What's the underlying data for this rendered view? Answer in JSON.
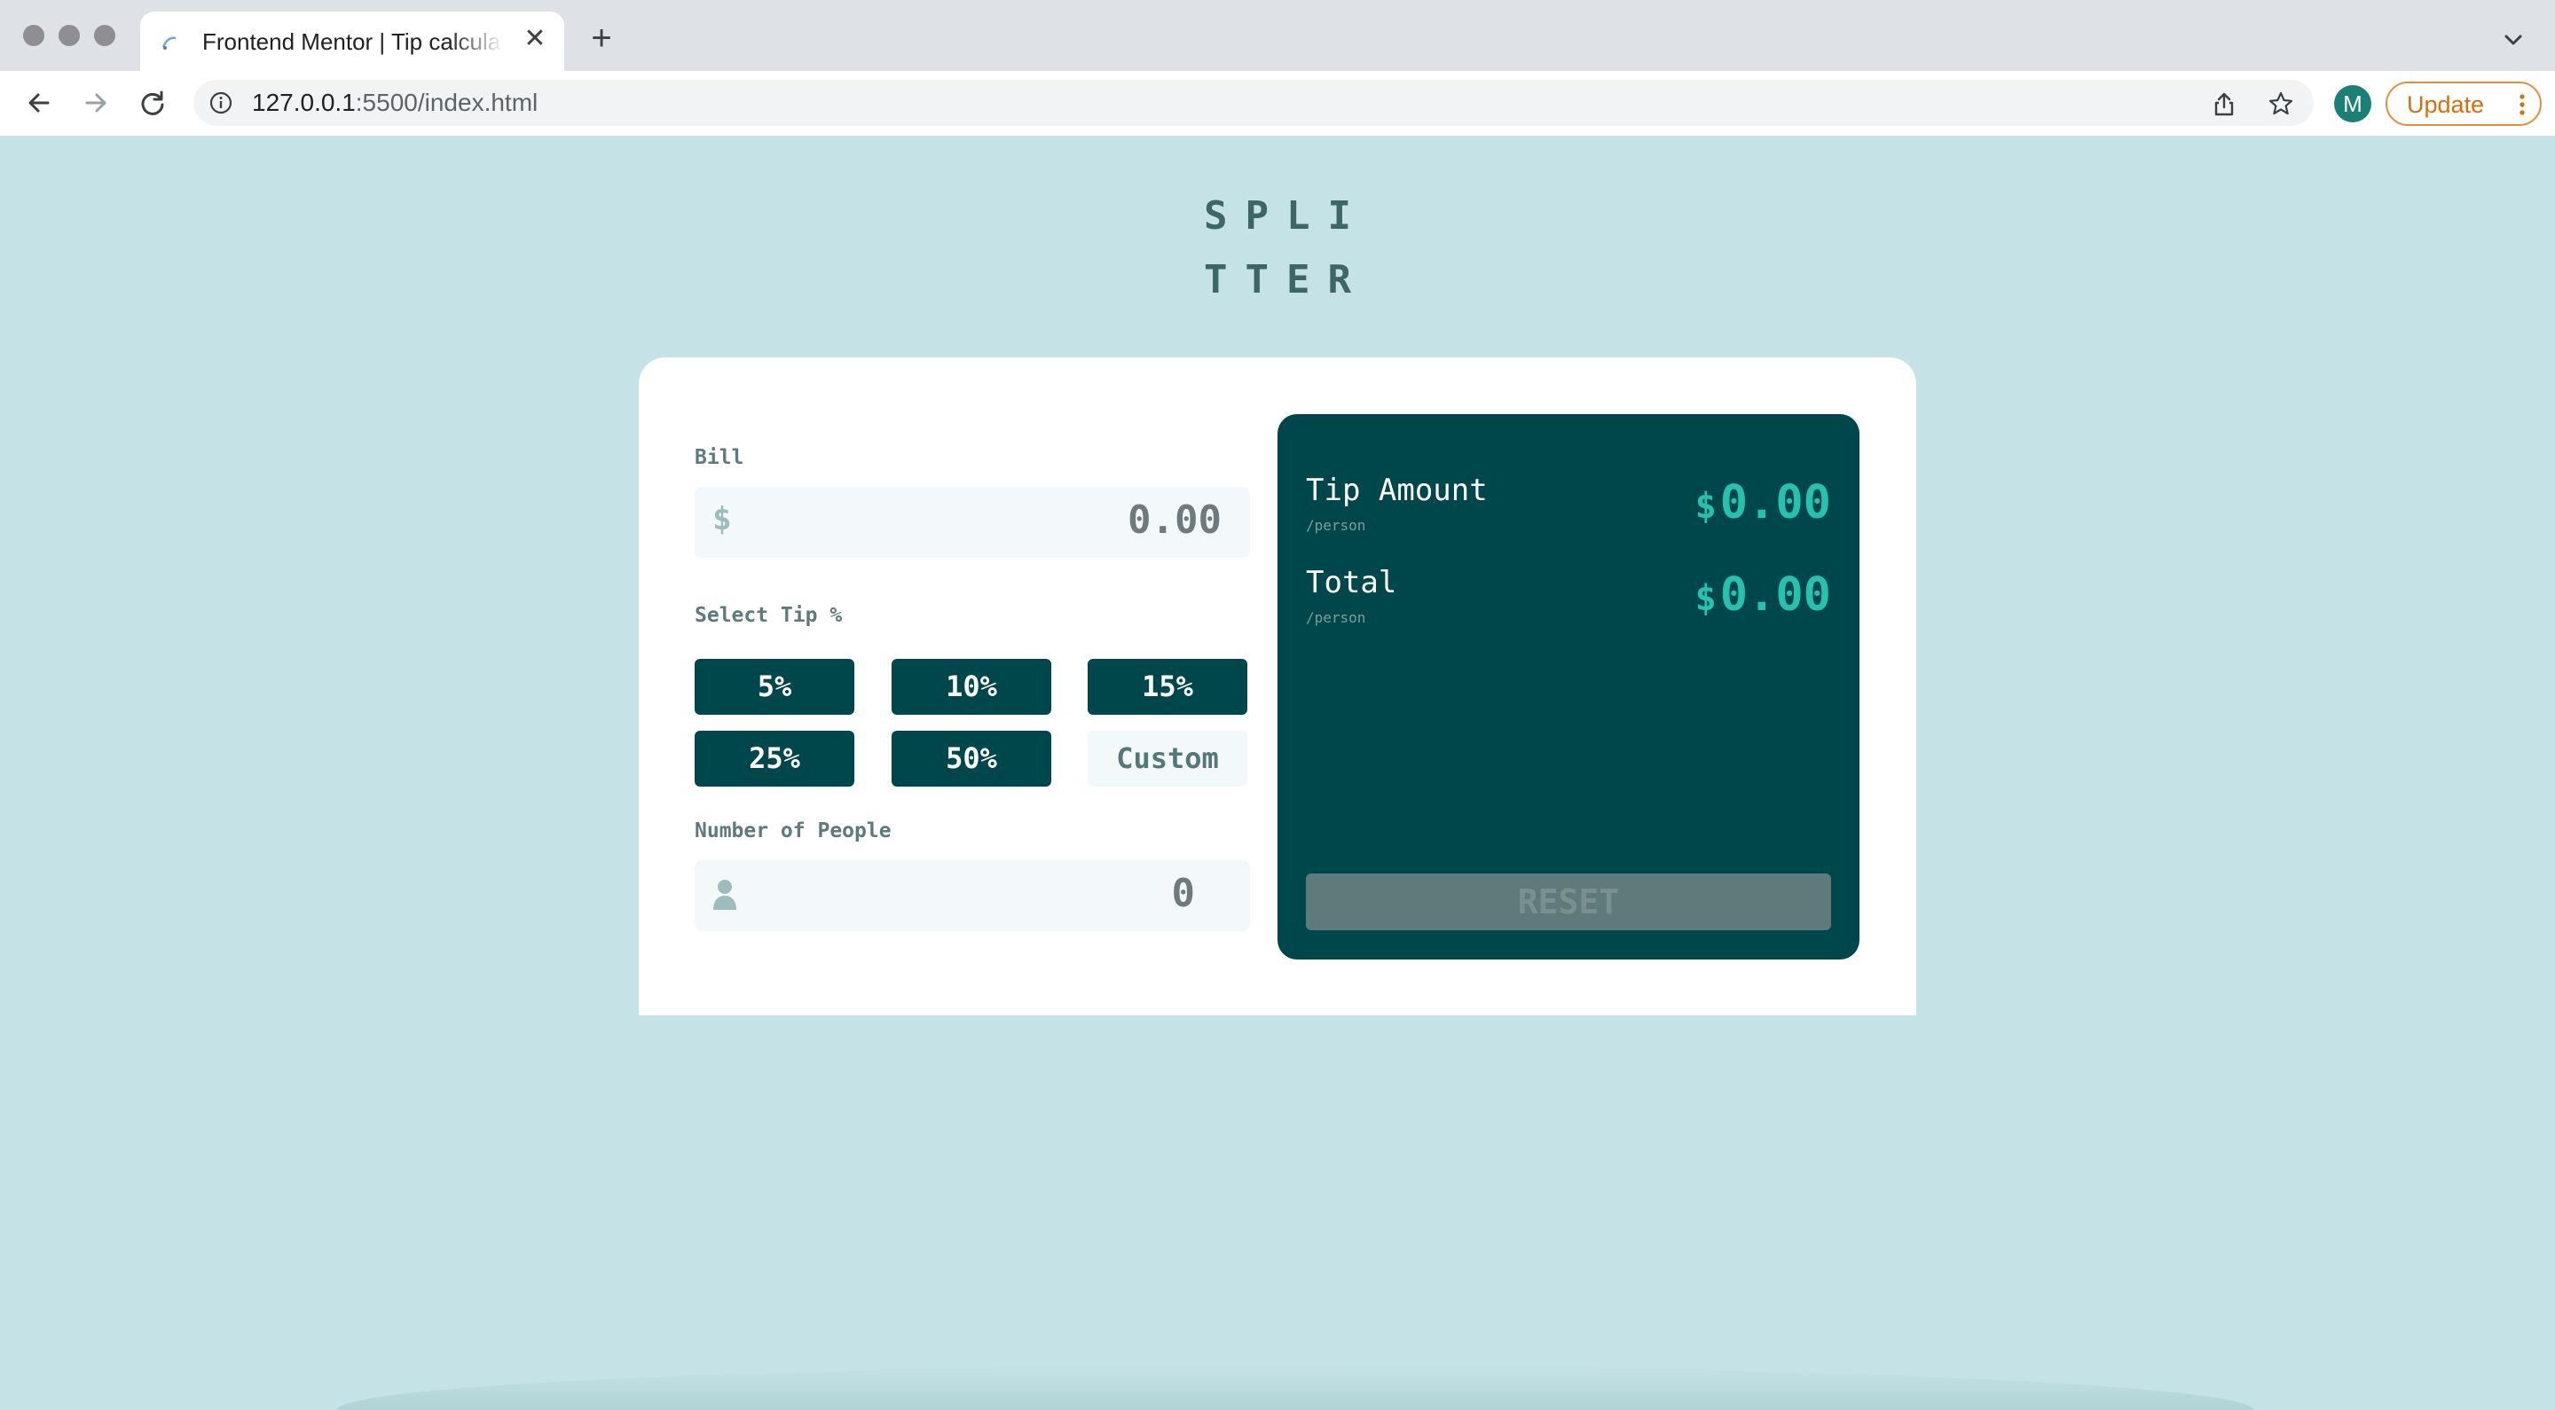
{
  "browser": {
    "tab_title": "Frontend Mentor | Tip calculator app",
    "close_glyph": "✕",
    "new_tab_glyph": "+",
    "url_host": "127.0.0.1",
    "url_rest": ":5500/index.html",
    "avatar_letter": "M",
    "update_label": "Update",
    "colors": {
      "tabbar": "#dee1e6",
      "toolbar": "#ffffff",
      "update_border": "#e0913c",
      "avatar": "#1a7f74"
    },
    "icons": [
      "back-icon",
      "forward-icon",
      "reload-icon",
      "info-icon",
      "share-icon",
      "star-icon",
      "chevron-down-icon",
      "kebab-menu-icon"
    ]
  },
  "app": {
    "logo_line1": "SPLI",
    "logo_line2": "TTER",
    "bill": {
      "label": "Bill",
      "currency_icon": "$",
      "value": "0.00"
    },
    "tip": {
      "label": "Select Tip %",
      "options": [
        "5%",
        "10%",
        "15%",
        "25%",
        "50%"
      ],
      "custom_placeholder": "Custom"
    },
    "people": {
      "label": "Number of People",
      "value": "0",
      "icon": "person-icon"
    },
    "results": {
      "tip_amount_label": "Tip Amount",
      "tip_amount_sub": "/person",
      "tip_amount_currency": "$",
      "tip_amount_value": "0.00",
      "total_label": "Total",
      "total_sub": "/person",
      "total_currency": "$",
      "total_value": "0.00",
      "reset_label": "RESET"
    },
    "colors": {
      "background": "#c5e3e6",
      "card": "#ffffff",
      "dark_cyan": "#00474b",
      "accent": "#26c2ae",
      "input_bg": "#f3f9fa",
      "reset_disabled": "#5f7a7b"
    }
  }
}
